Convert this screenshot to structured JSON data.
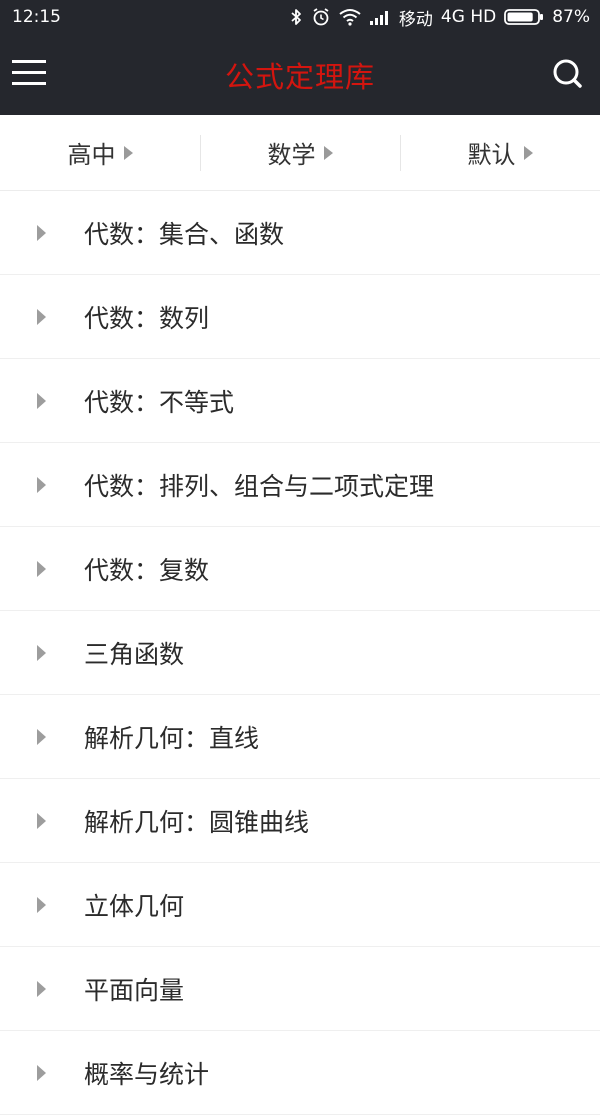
{
  "status_bar": {
    "time": "12:15",
    "carrier": "移动",
    "network": "4G HD",
    "battery": "87%",
    "battery_level": 0.87,
    "icons": [
      "bluetooth-icon",
      "alarm-icon",
      "wifi-icon",
      "signal-icon",
      "battery-icon"
    ]
  },
  "app_bar": {
    "title": "公式定理库",
    "title_color": "#d3150f",
    "background": "#25272d",
    "icons": [
      "menu-icon",
      "search-icon"
    ]
  },
  "filters": [
    {
      "label": "高中"
    },
    {
      "label": "数学"
    },
    {
      "label": "默认"
    }
  ],
  "topics": [
    {
      "label": "代数：集合、函数"
    },
    {
      "label": "代数：数列"
    },
    {
      "label": "代数：不等式"
    },
    {
      "label": "代数：排列、组合与二项式定理"
    },
    {
      "label": "代数：复数"
    },
    {
      "label": "三角函数"
    },
    {
      "label": "解析几何：直线"
    },
    {
      "label": "解析几何：圆锥曲线"
    },
    {
      "label": "立体几何"
    },
    {
      "label": "平面向量"
    },
    {
      "label": "概率与统计"
    }
  ]
}
